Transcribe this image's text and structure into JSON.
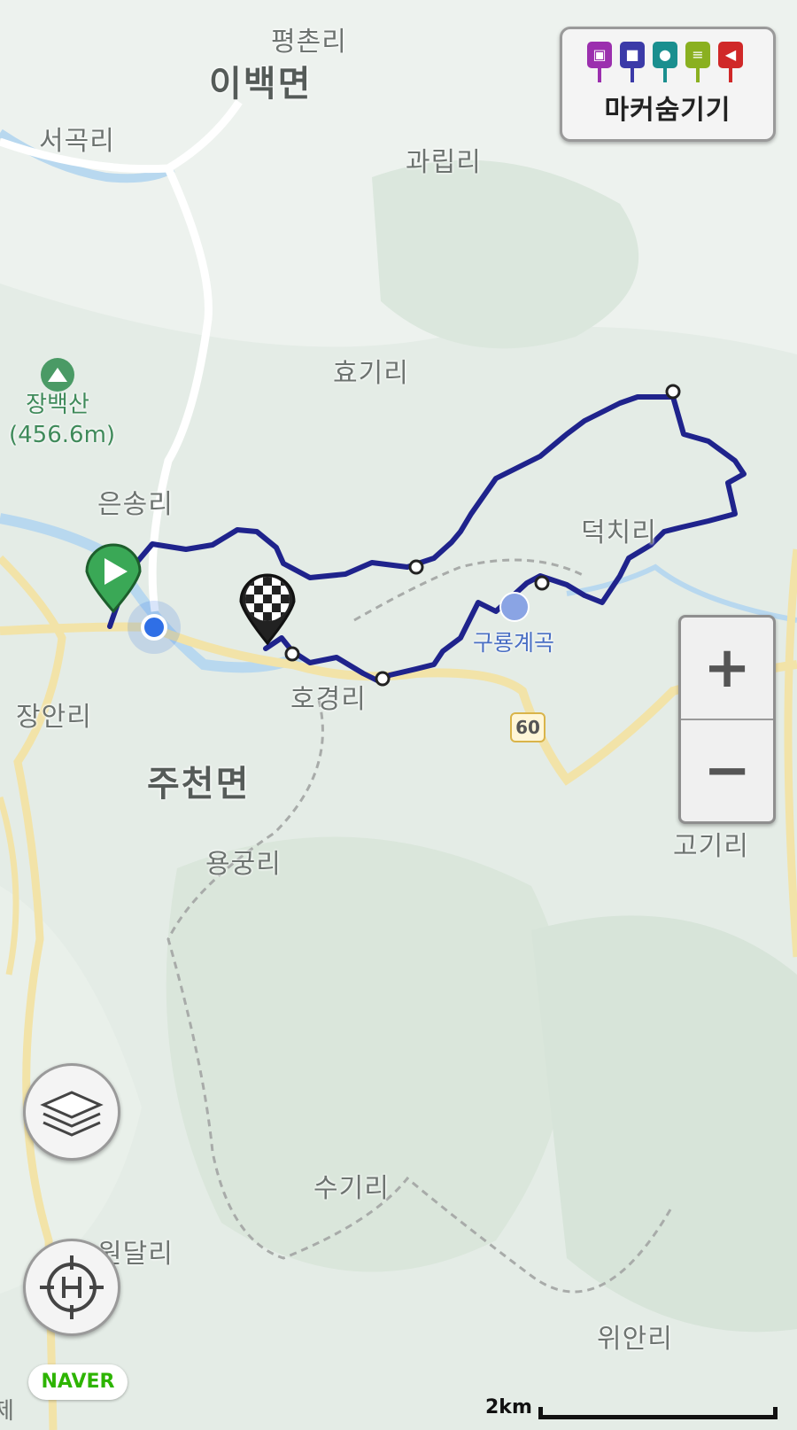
{
  "map": {
    "places": {
      "pyeongchon": "평촌리",
      "ibaek": "이백면",
      "seogok": "서곡리",
      "gwarip": "과립리",
      "hyogi": "효기리",
      "eunsong": "은송리",
      "deokchi": "덕치리",
      "hogyeong": "호경리",
      "jangan": "장안리",
      "jucheon": "주천면",
      "yonggung": "용궁리",
      "gogi": "고기리",
      "sugi": "수기리",
      "wondal": "원달리",
      "wian": "위안리",
      "edge": "제"
    },
    "mountain": {
      "name": "장백산",
      "elevation": "(456.6m)",
      "icon": "mountain-icon"
    },
    "poi": {
      "name": "구룡계곡",
      "icon": "valley-icon"
    },
    "route_number": "60"
  },
  "marker_panel": {
    "label": "마커숨기기",
    "pins": [
      {
        "icon": "camera-icon",
        "color": "#9b2fae",
        "glyph": "📷"
      },
      {
        "icon": "video-icon",
        "color": "#3b3aa8",
        "glyph": "▶"
      },
      {
        "icon": "microphone-icon",
        "color": "#1a8f8f",
        "glyph": "●"
      },
      {
        "icon": "memo-icon",
        "color": "#8ab020",
        "glyph": "≡"
      },
      {
        "icon": "flag-icon",
        "color": "#d02828",
        "glyph": "◀"
      }
    ]
  },
  "controls": {
    "zoom_in": "+",
    "zoom_out": "−",
    "layers_icon": "layers-icon",
    "locate_icon": "home-target-icon"
  },
  "brand": "NAVER",
  "scale": {
    "label": "2km"
  },
  "colors": {
    "track": "#1f238c",
    "start_marker": "#3aa856",
    "current_location": "#2f6fe6",
    "road_major": "#f2e3a8"
  }
}
